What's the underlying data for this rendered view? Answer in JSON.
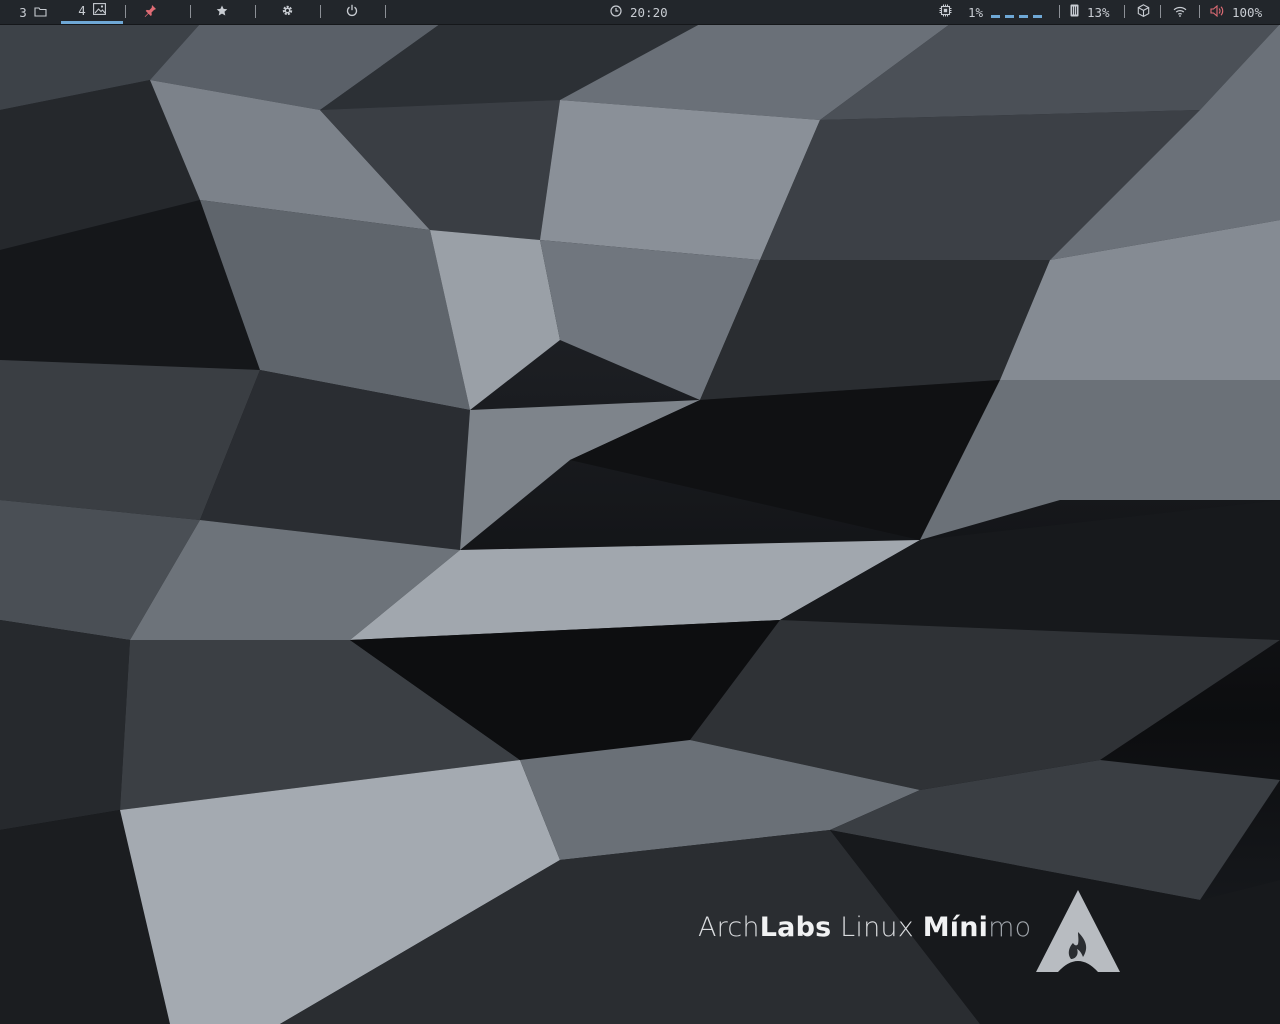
{
  "topbar": {
    "workspaces": [
      {
        "label": "3",
        "icon": "folder-icon",
        "active": false
      },
      {
        "label": "4",
        "icon": "image-icon",
        "active": true
      }
    ],
    "launchers": [
      {
        "icon": "pin-icon",
        "color": "#e06c75"
      },
      {
        "icon": "star-icon"
      },
      {
        "icon": "gear-icon"
      },
      {
        "icon": "power-icon"
      }
    ],
    "clock": {
      "icon": "clock-icon",
      "time": "20:20"
    },
    "cpu": {
      "icon": "cpu-icon",
      "value": "1%",
      "graph_color": "#6fa8d6"
    },
    "memory": {
      "icon": "memory-icon",
      "value": "13%"
    },
    "package": {
      "icon": "package-icon"
    },
    "wifi": {
      "icon": "wifi-icon"
    },
    "volume": {
      "icon": "volume-icon",
      "value": "100%",
      "icon_color": "#e06c75"
    }
  },
  "branding": {
    "part1": "Arch",
    "part2": "Labs",
    "part3": "Linux",
    "part4": "Míni",
    "part5": "mo",
    "logo": "archlabs-flame-logo"
  },
  "colors": {
    "accent": "#6fa8d6",
    "bar_bg": "#22262b",
    "bar_text": "#c8ccd2",
    "alert": "#e06c75"
  }
}
